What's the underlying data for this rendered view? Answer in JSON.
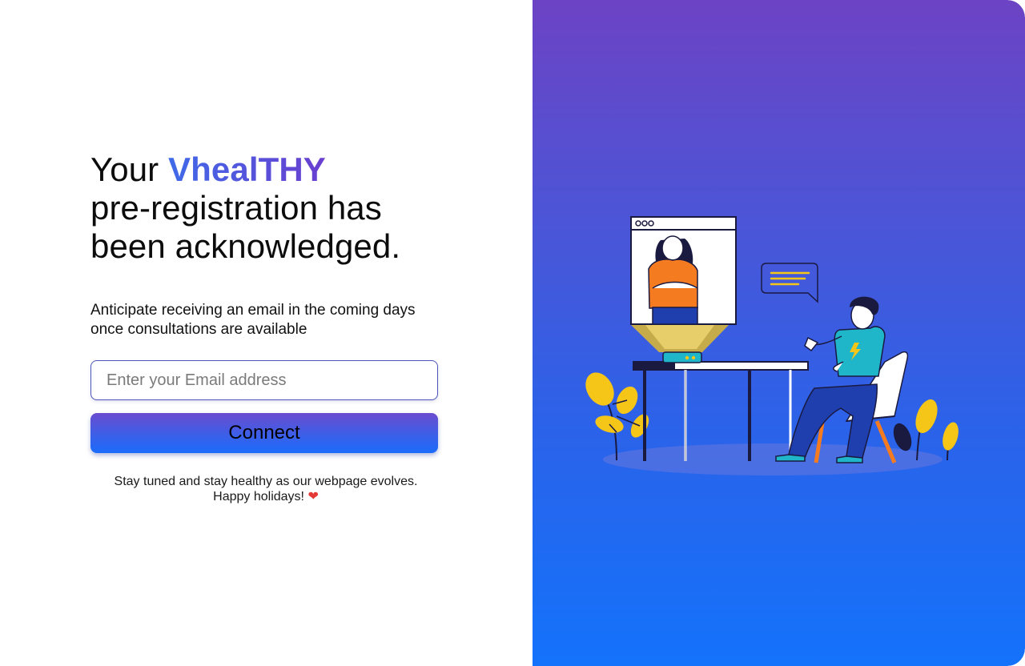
{
  "heading": {
    "prefix": "Your",
    "brand": "VhealTHY",
    "line2": "pre-registration has",
    "line3": "been acknowledged."
  },
  "subtext": {
    "line1": "Anticipate receiving an email in the coming days",
    "line2": "once consultations are available"
  },
  "email_input": {
    "placeholder": "Enter your Email address",
    "value": ""
  },
  "connect_button": {
    "label": "Connect"
  },
  "footnote": {
    "line1": "Stay tuned and stay healthy as our webpage evolves.",
    "line2": "Happy holidays!",
    "heart": "❤"
  },
  "colors": {
    "brand_gradient_start": "#3f6ae8",
    "brand_gradient_end": "#6a3fd0",
    "panel_top": "#6c43c4",
    "panel_bottom": "#1472fb",
    "accent_orange": "#f47b20",
    "accent_yellow": "#f5c518",
    "accent_teal": "#1fb6c9"
  },
  "illustration": {
    "icons": [
      "video-call-window-icon",
      "chat-bubble-icon",
      "projector-icon",
      "plant-icon"
    ]
  }
}
